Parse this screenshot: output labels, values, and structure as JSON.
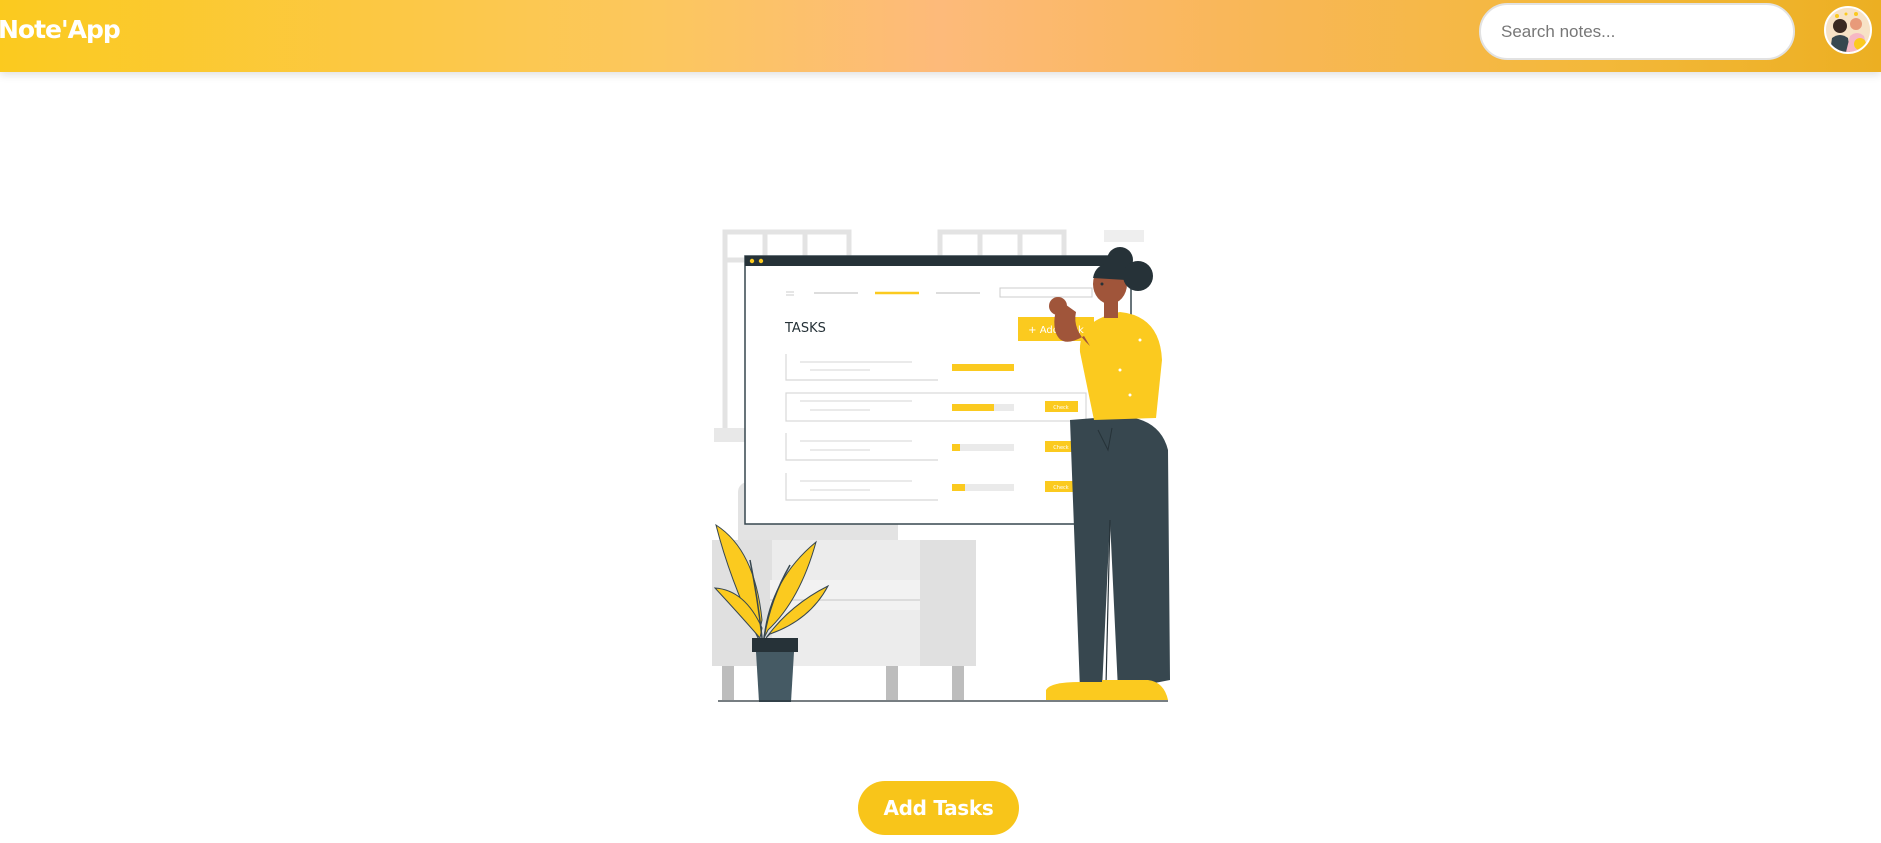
{
  "header": {
    "logo": "Note'App",
    "search_placeholder": "Search notes..."
  },
  "illustration": {
    "heading": "TASKS",
    "add_task_label": "+ Add Task",
    "check_label": "Check"
  },
  "main": {
    "add_tasks_label": "Add Tasks"
  },
  "colors": {
    "accent": "#f8c51a",
    "dark": "#37474f",
    "header_gradient_start": "#fbca1f",
    "header_gradient_mid": "#fdba7a",
    "header_gradient_end": "#ecaf22"
  }
}
